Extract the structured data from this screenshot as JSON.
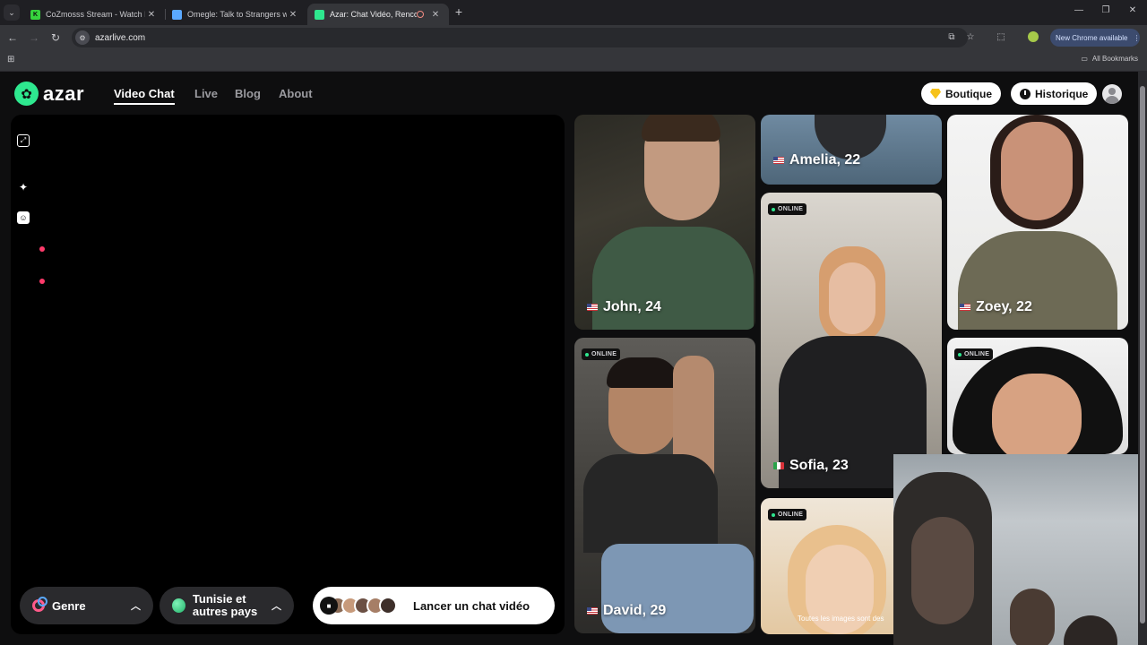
{
  "browser": {
    "tabs": [
      {
        "title": "CoZmosss Stream - Watch Live",
        "favicon": "K",
        "color": "#36d33d",
        "active": false
      },
      {
        "title": "Omegle: Talk to Strangers with",
        "favicon": "",
        "color": "#5aa9ff",
        "active": false
      },
      {
        "title": "Azar: Chat Vidéo, Rencontr",
        "favicon": "",
        "color": "#2ee88f",
        "active": true
      }
    ],
    "url": "azarlive.com",
    "new_chrome": "New Chrome available",
    "all_bookmarks": "All Bookmarks"
  },
  "site": {
    "logo": "azar",
    "nav": [
      {
        "label": "Video Chat",
        "active": true
      },
      {
        "label": "Live",
        "active": false
      },
      {
        "label": "Blog",
        "active": false
      },
      {
        "label": "About",
        "active": false
      }
    ],
    "boutique": "Boutique",
    "historique": "Historique"
  },
  "controls": {
    "genre": "Genre",
    "country": "Tunisie et autres pays",
    "launch": "Lancer un chat vidéo"
  },
  "profiles": [
    {
      "name": "John, 24",
      "flag": "us",
      "online": false
    },
    {
      "name": "Amelia, 22",
      "flag": "us",
      "online": false
    },
    {
      "name": "Zoey, 22",
      "flag": "us",
      "online": false
    },
    {
      "name": "David, 29",
      "flag": "us",
      "online": true
    },
    {
      "name": "Sofia, 23",
      "flag": "it",
      "online": true
    },
    {
      "name": "",
      "flag": "",
      "online": true
    },
    {
      "name": "",
      "flag": "",
      "online": true
    }
  ],
  "online_label": "ONLINE",
  "disclaimer": "Toutes les images sont des",
  "colors": {
    "accent": "#2ee88f",
    "brand_dark": "#0e0e0f",
    "pill_gold": "#f6c21a"
  }
}
